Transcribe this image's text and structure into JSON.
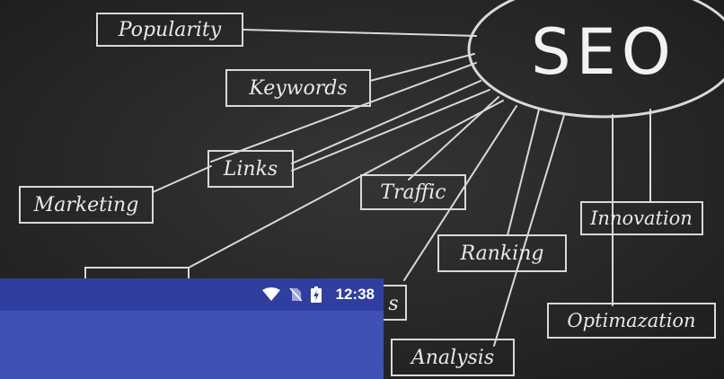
{
  "diagram": {
    "center": "SEO",
    "nodes": [
      {
        "id": "popularity",
        "label": "Popularity"
      },
      {
        "id": "keywords",
        "label": "Keywords"
      },
      {
        "id": "links",
        "label": "Links"
      },
      {
        "id": "marketing",
        "label": "Marketing"
      },
      {
        "id": "traffic",
        "label": "Traffic"
      },
      {
        "id": "innovation",
        "label": "Innovation"
      },
      {
        "id": "ranking",
        "label": "Ranking"
      },
      {
        "id": "optimazation",
        "label": "Optimazation"
      },
      {
        "id": "analysis",
        "label": "Analysis"
      },
      {
        "id": "partial",
        "label": "s"
      }
    ]
  },
  "status_bar": {
    "time": "12:38",
    "icons": [
      "wifi-icon",
      "no-sim-icon",
      "battery-charging-icon"
    ]
  },
  "colors": {
    "chalkboard": "#262626",
    "chalk": "#e9e9e9",
    "status_bar": "#303f9f",
    "app_bar": "#3f51b5"
  }
}
